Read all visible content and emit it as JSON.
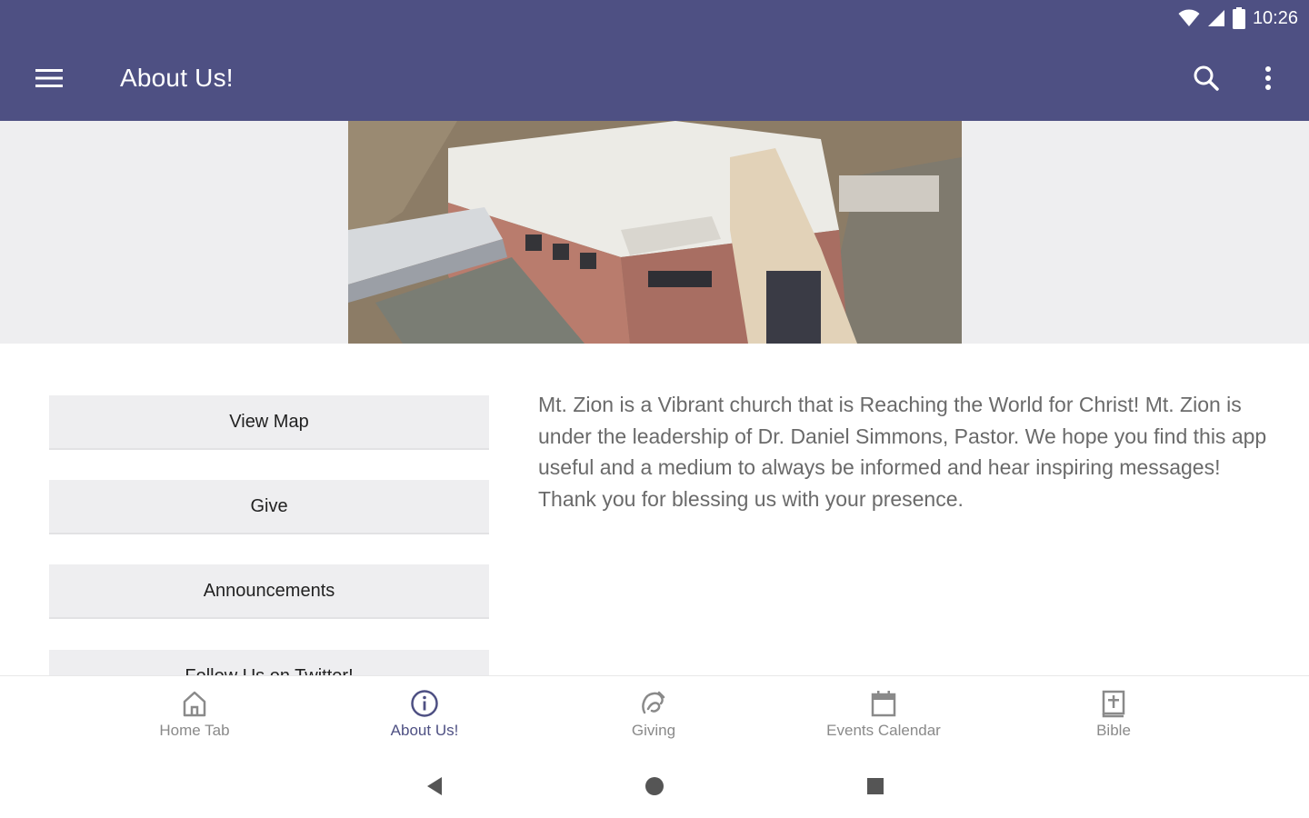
{
  "status_bar": {
    "time": "10:26",
    "wifi_icon": "wifi-icon",
    "signal_icon": "cell-signal-icon",
    "battery_icon": "battery-icon"
  },
  "app_bar": {
    "title": "About Us!",
    "menu_icon": "hamburger-menu-icon",
    "search_icon": "search-icon",
    "more_icon": "more-vertical-icon",
    "color": "#4e5083"
  },
  "banner": {
    "image": "church-building-aerial-photo"
  },
  "buttons": [
    {
      "label": "View Map"
    },
    {
      "label": "Give"
    },
    {
      "label": "Announcements"
    },
    {
      "label": "Follow Us on Twitter!"
    }
  ],
  "description": "Mt. Zion is a Vibrant church that is Reaching the World for Christ!   Mt. Zion is under the leadership of Dr. Daniel Simmons, Pastor.  We hope you find this app useful and a medium to always be informed and hear inspiring messages!  Thank you for blessing us with your presence.",
  "bottom_nav": [
    {
      "label": "Home Tab",
      "icon": "home-icon",
      "active": false
    },
    {
      "label": "About Us!",
      "icon": "info-icon",
      "active": true
    },
    {
      "label": "Giving",
      "icon": "giving-hand-icon",
      "active": false
    },
    {
      "label": "Events Calendar",
      "icon": "calendar-icon",
      "active": false
    },
    {
      "label": "Bible",
      "icon": "bible-icon",
      "active": false
    }
  ],
  "system_nav": {
    "back_icon": "back-triangle-icon",
    "home_icon": "home-circle-icon",
    "recents_icon": "recents-square-icon"
  },
  "colors": {
    "accent": "#4e5083",
    "active_tab": "#4e5083",
    "inactive_tab": "#8a8a8a"
  }
}
